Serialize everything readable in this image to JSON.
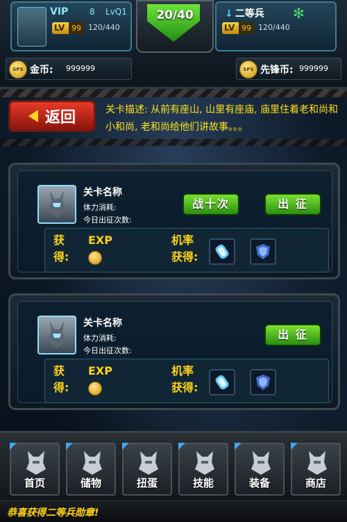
{
  "header": {
    "vip_label": "VIP",
    "vip_level": "8",
    "lv_tag": "LvQ1",
    "lv_badge": "LV",
    "lv_value": "99",
    "exp": "120/440",
    "stamina": "20/40",
    "rank": "二等兵",
    "lv_badge_right": "LV",
    "lv_value_right": "99",
    "exp_right": "120/440"
  },
  "currency": {
    "coin_icon_text": "SPS",
    "gold_label": "金币:",
    "gold_value": "999999",
    "vanguard_label": "先锋币:",
    "vanguard_value": "999999"
  },
  "back_button": "返回",
  "description": "关卡描述: 从前有座山, 山里有座庙, 庙里住着老和尚和小和尚, 老和尚给他们讲故事。。。",
  "stages": [
    {
      "name": "关卡名称",
      "stamina_label": "体力消耗:",
      "today_label": "今日出征次数:",
      "battle_ten": "战十次",
      "go": "出 征",
      "gain_1": "获",
      "gain_2": "得:",
      "exp": "EXP",
      "chance_1": "机率",
      "chance_2": "获得:"
    },
    {
      "name": "关卡名称",
      "stamina_label": "体力消耗:",
      "today_label": "今日出征次数:",
      "go": "出 征",
      "gain_1": "获",
      "gain_2": "得:",
      "exp": "EXP",
      "chance_1": "机率",
      "chance_2": "获得:"
    }
  ],
  "nav": [
    {
      "label": "首页",
      "icon": "robot-head-icon"
    },
    {
      "label": "储物",
      "icon": "robot-head-icon"
    },
    {
      "label": "扭蛋",
      "icon": "robot-head-icon"
    },
    {
      "label": "技能",
      "icon": "robot-head-icon"
    },
    {
      "label": "装备",
      "icon": "robot-head-icon"
    },
    {
      "label": "商店",
      "icon": "robot-head-icon"
    }
  ],
  "ticker": "恭喜获得二等兵勋章!",
  "colors": {
    "accent_yellow": "#ffd21a",
    "button_green": "#4cbc20",
    "back_red": "#d12a1a"
  }
}
